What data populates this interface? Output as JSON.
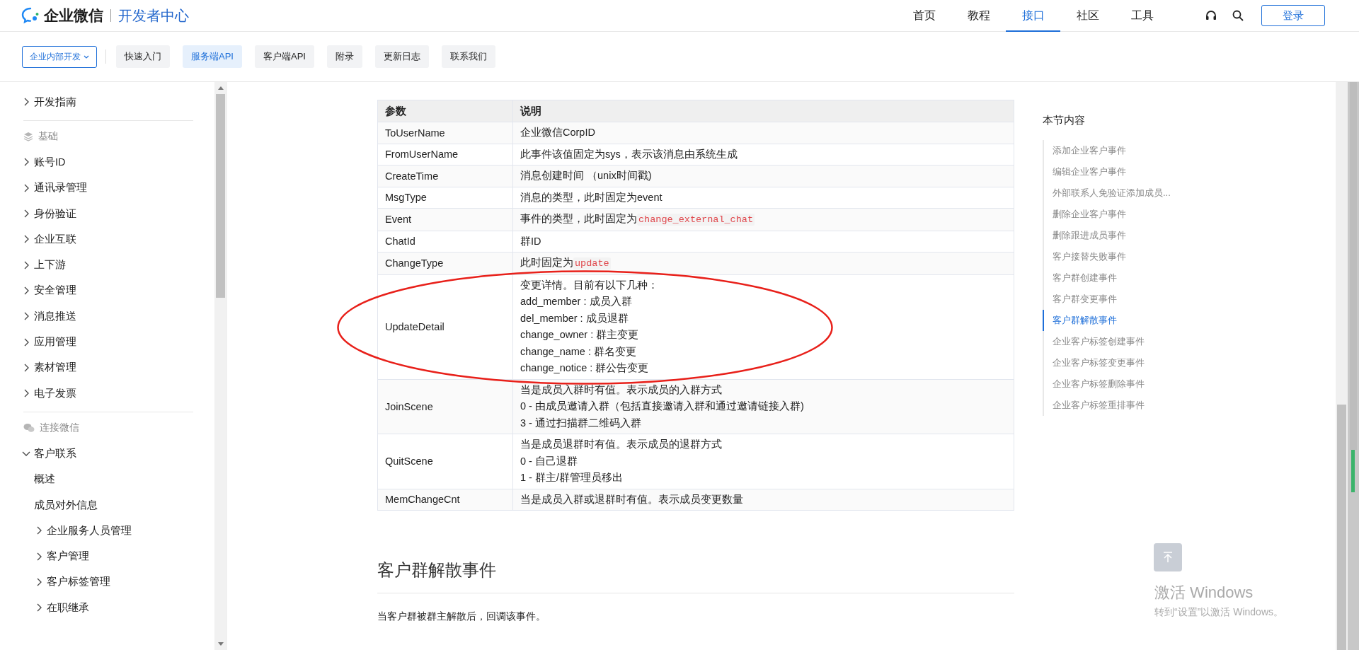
{
  "header": {
    "brand": "企业微信",
    "subtitle": "开发者中心",
    "nav": [
      {
        "label": "首页",
        "selected": false
      },
      {
        "label": "教程",
        "selected": false
      },
      {
        "label": "接口",
        "selected": true
      },
      {
        "label": "社区",
        "selected": false
      },
      {
        "label": "工具",
        "selected": false
      }
    ],
    "login": "登录"
  },
  "subnav": {
    "dropdown": "企业内部开发",
    "tabs": [
      {
        "label": "快速入门",
        "selected": false
      },
      {
        "label": "服务端API",
        "selected": true
      },
      {
        "label": "客户端API",
        "selected": false
      },
      {
        "label": "附录",
        "selected": false
      },
      {
        "label": "更新日志",
        "selected": false
      },
      {
        "label": "联系我们",
        "selected": false
      }
    ]
  },
  "sidebar": {
    "sections": [
      {
        "items": [
          {
            "label": "开发指南",
            "kind": "folder",
            "expanded": false
          }
        ]
      },
      {
        "title": "基础",
        "kind": "layers",
        "items": [
          {
            "label": "账号ID",
            "kind": "folder",
            "expanded": false
          },
          {
            "label": "通讯录管理",
            "kind": "folder",
            "expanded": false
          },
          {
            "label": "身份验证",
            "kind": "folder",
            "expanded": false
          },
          {
            "label": "企业互联",
            "kind": "folder",
            "expanded": false
          },
          {
            "label": "上下游",
            "kind": "folder",
            "expanded": false
          },
          {
            "label": "安全管理",
            "kind": "folder",
            "expanded": false
          },
          {
            "label": "消息推送",
            "kind": "folder",
            "expanded": false
          },
          {
            "label": "应用管理",
            "kind": "folder",
            "expanded": false
          },
          {
            "label": "素材管理",
            "kind": "folder",
            "expanded": false
          },
          {
            "label": "电子发票",
            "kind": "folder",
            "expanded": false
          }
        ]
      },
      {
        "title": "连接微信",
        "kind": "chat",
        "items": [
          {
            "label": "客户联系",
            "kind": "folder",
            "expanded": true,
            "children": [
              {
                "label": "概述",
                "kind": "leaf"
              },
              {
                "label": "成员对外信息",
                "kind": "leaf"
              },
              {
                "label": "企业服务人员管理",
                "kind": "folder",
                "expanded": false
              },
              {
                "label": "客户管理",
                "kind": "folder",
                "expanded": false
              },
              {
                "label": "客户标签管理",
                "kind": "folder",
                "expanded": false
              },
              {
                "label": "在职继承",
                "kind": "folder",
                "expanded": false
              }
            ]
          }
        ]
      }
    ]
  },
  "table": {
    "columns": [
      "参数",
      "说明"
    ],
    "rows": [
      {
        "name": "ToUserName",
        "lines": [
          "企业微信CorpID"
        ]
      },
      {
        "name": "FromUserName",
        "lines": [
          "此事件该值固定为sys，表示该消息由系统生成"
        ]
      },
      {
        "name": "CreateTime",
        "lines": [
          "消息创建时间 （unix时间戳)"
        ]
      },
      {
        "name": "MsgType",
        "lines": [
          "消息的类型，此时固定为event"
        ]
      },
      {
        "name": "Event",
        "lines": [
          "事件的类型，此时固定为"
        ],
        "code": "change_external_chat"
      },
      {
        "name": "ChatId",
        "lines": [
          "群ID"
        ]
      },
      {
        "name": "ChangeType",
        "lines": [
          "此时固定为"
        ],
        "code": "update"
      },
      {
        "name": "UpdateDetail",
        "lines": [
          "变更详情。目前有以下几种：",
          "add_member : 成员入群",
          "del_member : 成员退群",
          "change_owner : 群主变更",
          "change_name : 群名变更",
          "change_notice : 群公告变更"
        ]
      },
      {
        "name": "JoinScene",
        "lines": [
          "当是成员入群时有值。表示成员的入群方式",
          "0 - 由成员邀请入群（包括直接邀请入群和通过邀请链接入群)",
          "3 - 通过扫描群二维码入群"
        ]
      },
      {
        "name": "QuitScene",
        "lines": [
          "当是成员退群时有值。表示成员的退群方式",
          "0 - 自己退群",
          "1 - 群主/群管理员移出"
        ]
      },
      {
        "name": "MemChangeCnt",
        "lines": [
          "当是成员入群或退群时有值。表示成员变更数量"
        ]
      }
    ]
  },
  "section_heading": "客户群解散事件",
  "paragraph": "当客户群被群主解散后，回调该事件。",
  "toc": {
    "title": "本节内容",
    "items": [
      {
        "label": "添加企业客户事件",
        "selected": false
      },
      {
        "label": "编辑企业客户事件",
        "selected": false
      },
      {
        "label": "外部联系人免验证添加成员...",
        "selected": false
      },
      {
        "label": "删除企业客户事件",
        "selected": false
      },
      {
        "label": "删除跟进成员事件",
        "selected": false
      },
      {
        "label": "客户接替失败事件",
        "selected": false
      },
      {
        "label": "客户群创建事件",
        "selected": false
      },
      {
        "label": "客户群变更事件",
        "selected": false
      },
      {
        "label": "客户群解散事件",
        "selected": true
      },
      {
        "label": "企业客户标签创建事件",
        "selected": false
      },
      {
        "label": "企业客户标签变更事件",
        "selected": false
      },
      {
        "label": "企业客户标签删除事件",
        "selected": false
      },
      {
        "label": "企业客户标签重排事件",
        "selected": false
      }
    ]
  },
  "windows_notice": {
    "title": "激活 Windows",
    "subtitle": "转到“设置”以激活 Windows。"
  }
}
